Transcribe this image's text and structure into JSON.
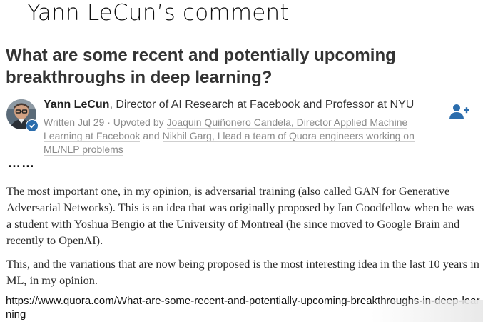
{
  "slide": {
    "title": "Yann LeCun’s comment"
  },
  "post": {
    "question": "What are some recent and potentially upcoming breakthroughs in deep learning?",
    "author_name": "Yann LeCun",
    "author_title": ", Director of AI Research at Facebook and Professor at NYU",
    "written": "Written Jul 29",
    "upvoted_prefix": " · Upvoted by ",
    "upvoter1": "Joaquin Quiñonero Candela, Director Applied Machine Learning at Facebook",
    "upvoter_sep": " and ",
    "upvoter2": "Nikhil Garg, I lead a team of Quora engineers working on ML/NLP problems",
    "ellipsis": "……",
    "paragraph1": "The most important one, in my opinion, is adversarial training (also called GAN for Generative Adversarial Networks). This is an idea that was originally proposed by Ian Goodfellow when he was a student with Yoshua Bengio at the University of Montreal (he since moved to Google Brain and recently to OpenAI).",
    "paragraph2": "This, and the variations that are now being proposed is the most interesting idea in the last 10 years in ML, in my opinion."
  },
  "source": {
    "url": "https://www.quora.com/What-are-some-recent-and-potentially-upcoming-breakthroughs-in-deep-learning"
  },
  "icons": {
    "follow": "person-add-icon",
    "verified": "check-badge-icon",
    "avatar": "avatar"
  },
  "colors": {
    "accent": "#2b6dad",
    "meta_text": "#8a8a8a"
  }
}
